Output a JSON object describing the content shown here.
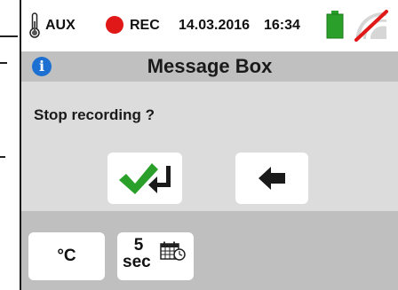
{
  "statusbar": {
    "aux_label": "AUX",
    "rec_label": "REC",
    "date": "14.03.2016",
    "time": "16:34"
  },
  "dialog": {
    "title": "Message Box",
    "message": "Stop recording ?"
  },
  "bottom": {
    "unit_label": "°C",
    "interval_value": "5",
    "interval_unit": "sec"
  },
  "colors": {
    "rec": "#e01818",
    "battery": "#2aa02a",
    "info": "#1d6fd1",
    "confirm_check": "#2aa02a",
    "title_bar": "#c0c0c0",
    "content_bg": "#dcdcdc",
    "bottom_bar": "#bfbfbf"
  },
  "icons": [
    "thermometer-icon",
    "rec-dot-icon",
    "battery-icon",
    "wifi-off-icon",
    "info-icon",
    "check-enter-icon",
    "back-arrow-icon",
    "calendar-clock-icon"
  ]
}
